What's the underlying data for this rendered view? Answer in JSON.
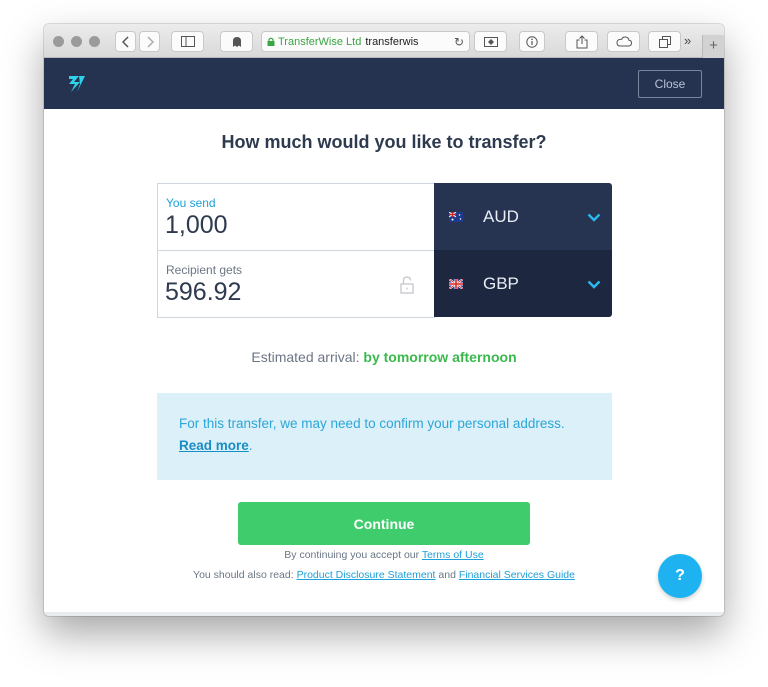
{
  "browser": {
    "address_org": "TransferWise Ltd",
    "address_url": "transferwis",
    "more_label": "»",
    "new_tab_label": "+"
  },
  "header": {
    "logo_icon": "transferwise-logo",
    "close_label": "Close"
  },
  "main": {
    "title": "How much would you like to transfer?",
    "send": {
      "label": "You send",
      "value": "1,000",
      "currency": "AUD"
    },
    "receive": {
      "label": "Recipient gets",
      "value": "596.92",
      "currency": "GBP"
    },
    "arrival_label": "Estimated arrival: ",
    "arrival_value": "by tomorrow afternoon",
    "notice_text": "For this transfer, we may need to confirm your personal address. ",
    "notice_link": "Read more",
    "notice_end": ".",
    "continue_label": "Continue",
    "legal_prefix": "By continuing you accept our ",
    "terms_link": "Terms of Use",
    "legal2_prefix": "You should also read: ",
    "pds_link": "Product Disclosure Statement",
    "legal2_and": " and ",
    "fsg_link": "Financial Services Guide",
    "help_label": "?"
  },
  "colors": {
    "header_bg": "#253350",
    "accent_blue": "#1ea0d8",
    "success_green": "#3fcc6c",
    "notice_bg": "#dbf0f8"
  }
}
